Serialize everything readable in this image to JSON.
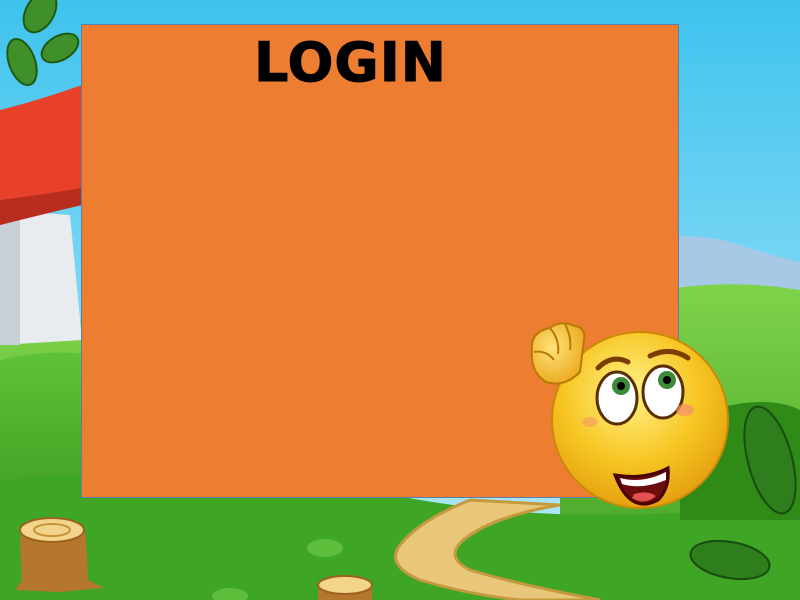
{
  "login_panel": {
    "title": "LOGIN",
    "background_color": "#ED7D31"
  },
  "mascot": {
    "icon": "thinking-smiley-icon"
  },
  "scene": {
    "sky_color": "#5FD0F2",
    "grass_color": "#4CB630",
    "roof_color": "#E8412A"
  }
}
